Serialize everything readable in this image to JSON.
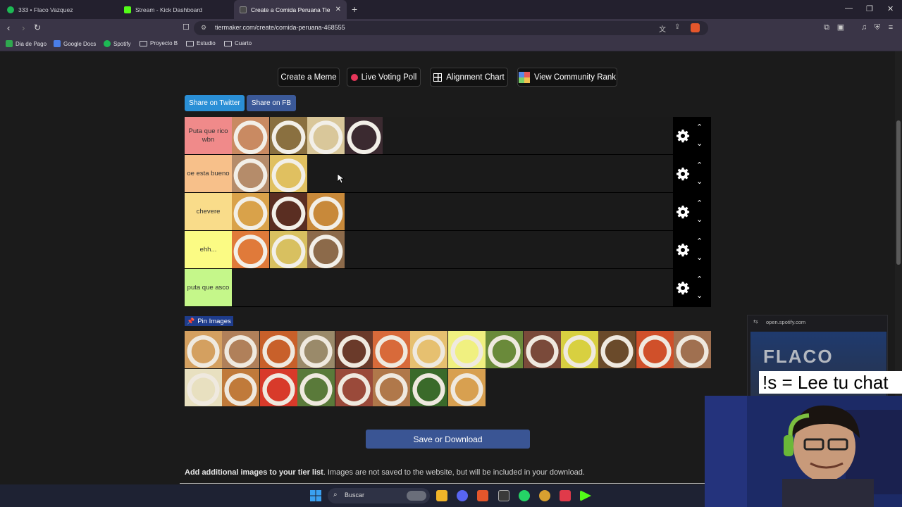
{
  "browser": {
    "tabs": [
      {
        "title": "333 • Flaco Vazquez",
        "favicon_color": "#1db954"
      },
      {
        "title": "Stream - Kick Dashboard",
        "favicon_color": "#53fc18"
      },
      {
        "title": "Create a Comida Peruana Tier Li",
        "favicon_color": "#4a4a4a"
      }
    ],
    "url": "tiermaker.com/create/comida-peruana-468555",
    "bookmarks": [
      "Dia de Pago",
      "Google Docs",
      "Spotify",
      "Proyecto B",
      "Estudio",
      "Cuarto"
    ]
  },
  "toolbar": {
    "create_meme": "Create a Meme",
    "live_poll": "Live Voting Poll",
    "alignment_chart": "Alignment Chart",
    "community_rank": "View Community Rank",
    "share_twitter": "Share on Twitter",
    "share_fb": "Share on FB"
  },
  "tiers": [
    {
      "label": "Puta que rico wbn",
      "color": "#f08a8a",
      "images": [
        "#c98a62",
        "#8a7040",
        "#d9c79a",
        "#3b2a30"
      ]
    },
    {
      "label": "oe esta bueno",
      "color": "#f7c08a",
      "images": [
        "#b58c6a",
        "#e0c060"
      ]
    },
    {
      "label": "chevere",
      "color": "#f9dc8a",
      "images": [
        "#d9a24a",
        "#5a2e22",
        "#c8893a"
      ]
    },
    {
      "label": "ehh...",
      "color": "#fbfb84",
      "images": [
        "#e07a3a",
        "#d8c060",
        "#8c6a4a"
      ]
    },
    {
      "label": "puta que asco",
      "color": "#c5f78a",
      "images": []
    }
  ],
  "pool": {
    "pin_label": "Pin Images",
    "images": [
      "#d4a060",
      "#b0805a",
      "#c8602a",
      "#9a8a6a",
      "#6a3a2a",
      "#d86a3a",
      "#e6c070",
      "#f0f080",
      "#6a8a3a",
      "#7a4a3a",
      "#d8d040",
      "#6a4a2a",
      "#d0502a",
      "#a07050",
      "#e8e0c0",
      "#c07a3a",
      "#d83a2a",
      "#5a7a3a",
      "#9a4a3a",
      "#b0784a",
      "#3a6a2a",
      "#d8a050"
    ]
  },
  "save_button": "Save or Download",
  "add_images_note": {
    "bold": "Add additional images to your tier list",
    "rest": ". Images are not saved to the website, but will be included in your download."
  },
  "overlay": {
    "spotify_url": "open.spotify.com",
    "art_text": "FLACO",
    "chat_command": "!s = Lee tu chat"
  },
  "taskbar": {
    "search_placeholder": "Buscar"
  }
}
